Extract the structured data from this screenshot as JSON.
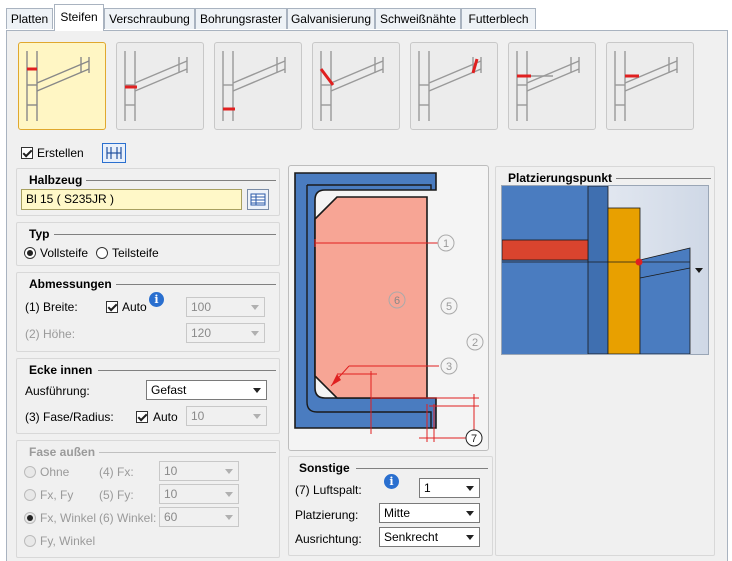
{
  "tabs": [
    "Platten",
    "Steifen",
    "Verschraubung",
    "Bohrungsraster",
    "Galvanisierung",
    "Schweißnähte",
    "Futterblech"
  ],
  "active_tab": "Steifen",
  "create": {
    "label": "Erstellen",
    "checked": true
  },
  "halbzeug": {
    "title": "Halbzeug",
    "value": "Bl 15  ( S235JR )"
  },
  "typ": {
    "title": "Typ",
    "options": [
      "Vollsteife",
      "Teilsteife"
    ],
    "selected": "Vollsteife"
  },
  "abmessungen": {
    "title": "Abmessungen",
    "breite_label": "(1) Breite:",
    "auto_label": "Auto",
    "breite_value": "100",
    "hoehe_label": "(2) Höhe:",
    "hoehe_value": "120"
  },
  "ecke_innen": {
    "title": "Ecke innen",
    "ausfuehrung_label": "Ausführung:",
    "ausfuehrung_value": "Gefast",
    "fase_label": "(3) Fase/Radius:",
    "auto_label": "Auto",
    "fase_value": "10"
  },
  "fase_aussen": {
    "title": "Fase außen",
    "opt_ohne": "Ohne",
    "opt_fxfy": "Fx, Fy",
    "opt_fxwinkel": "Fx, Winkel",
    "opt_fywinkel": "Fy, Winkel",
    "fx_label": "(4) Fx:",
    "fx_value": "10",
    "fy_label": "(5) Fy:",
    "fy_value": "10",
    "winkel_label": "(6) Winkel:",
    "winkel_value": "60"
  },
  "diagram": {
    "labels": [
      "1",
      "2",
      "3",
      "5",
      "6",
      "7"
    ]
  },
  "sonstige": {
    "title": "Sonstige",
    "luftspalt_label": "(7) Luftspalt:",
    "luftspalt_value": "1",
    "platzierung_label": "Platzierung:",
    "platzierung_value": "Mitte",
    "ausrichtung_label": "Ausrichtung:",
    "ausrichtung_value": "Senkrecht"
  },
  "platzierungspunkt": {
    "title": "Platzierungspunkt"
  },
  "colors": {
    "steel_blue": "#4a7cc0",
    "plate_salmon": "#f7a595",
    "accent_red": "#e02020",
    "orange": "#e8a000"
  }
}
